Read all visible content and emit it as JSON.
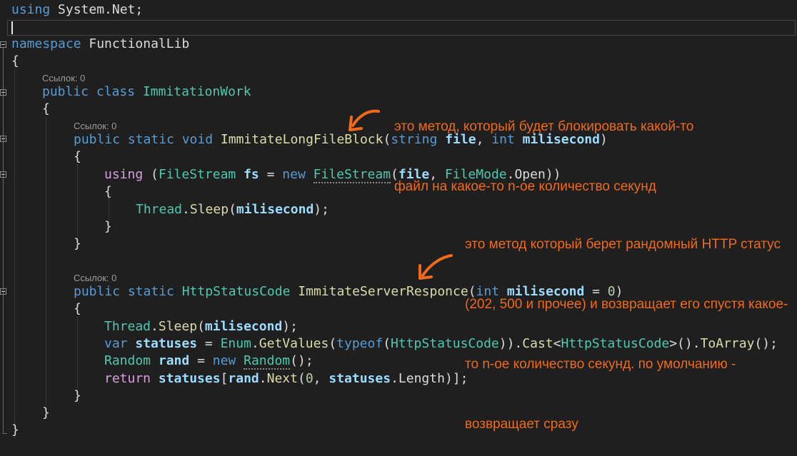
{
  "editor": {
    "lines": {
      "using_kw": "using",
      "using_ns": " System.Net;",
      "ns_kw": "namespace",
      "ns_name": " FunctionalLib",
      "brace_open": "{",
      "brace_close": "}",
      "class_mod": "public class ",
      "class_name": "ImmitationWork",
      "m1_mods": "public static void ",
      "m1_name": "ImmitateLongFileBlock",
      "m1_p1_type": "string",
      "m1_p1_name": "file",
      "m1_p2_type": "int",
      "m1_p2_name": "milisecond",
      "using_stmt_kw": "using",
      "fs_type": "FileStream",
      "fs_var": "fs",
      "new_kw": "new",
      "fs_ctor": "FileStream",
      "file_arg": "file",
      "filemode": "FileMode",
      "open": "Open",
      "thread": "Thread",
      "sleep": "Sleep",
      "milisecond": "milisecond",
      "m2_mods": "public static ",
      "m2_ret": "HttpStatusCode",
      "m2_name": "ImmitateServerResponce",
      "m2_p_type": "int",
      "m2_p_name": "milisecond",
      "m2_default": "0",
      "var_kw": "var",
      "statuses": "statuses",
      "enum": "Enum",
      "getvalues": "GetValues",
      "typeof": "typeof",
      "hsc": "HttpStatusCode",
      "cast": "Cast",
      "toarray": "ToArray",
      "random_type": "Random",
      "rand": "rand",
      "random_ctor": "Random",
      "return_kw": "return",
      "next": "Next",
      "zero": "0",
      "length": "Length"
    },
    "codelens": {
      "ref_class": "Ссылок: 0",
      "ref_m1": "Ссылок: 0",
      "ref_m2": "Ссылок: 0"
    }
  },
  "annotations": {
    "note1_line1": "это метод, который будет блокировать какой-то",
    "note1_line2": "файл на какое-то n-ое количество секунд",
    "note2_line1": "это метод который берет рандомный HTTP статус",
    "note2_line2": "(202, 500 и прочее) и возвращает его спустя какое-",
    "note2_line3": "то n-ое количество секунд. по умолчанию -",
    "note2_line4": "возвращает сразу",
    "color": "#f06a1a"
  }
}
